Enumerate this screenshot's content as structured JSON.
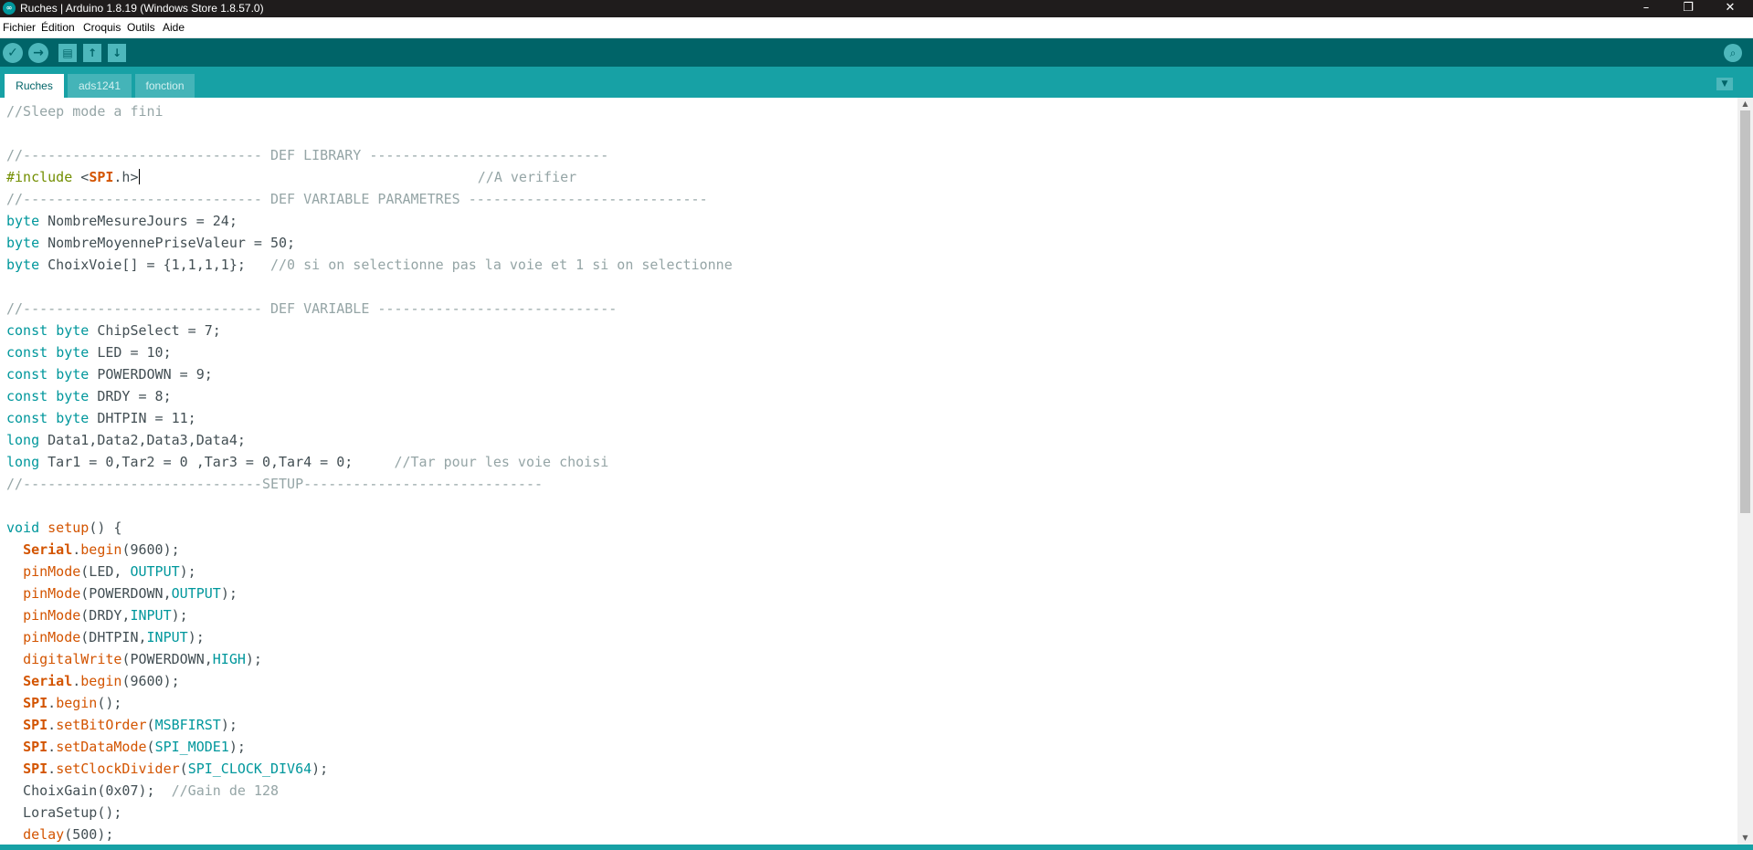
{
  "window": {
    "title": "Ruches | Arduino 1.8.19 (Windows Store 1.8.57.0)",
    "app_icon_text": "∞",
    "controls": {
      "minimize": "–",
      "restore": "❐",
      "close": "✕"
    }
  },
  "menu": [
    "Fichier",
    "Édition",
    "Croquis",
    "Outils",
    "Aide"
  ],
  "toolbar": {
    "verify_icon": "✓",
    "upload_icon": "→",
    "new_icon": "▤",
    "open_icon": "↑",
    "save_icon": "↓",
    "serial_monitor_icon": "⌕"
  },
  "tabs": [
    {
      "label": "Ruches",
      "active": true
    },
    {
      "label": "ads1241",
      "active": false
    },
    {
      "label": "fonction",
      "active": false
    }
  ],
  "tab_menu_icon": "▼",
  "code": [
    [
      [
        "cm",
        "//Sleep mode a fini"
      ]
    ],
    [],
    [
      [
        "cm",
        "//----------------------------- DEF LIBRARY -----------------------------"
      ]
    ],
    [
      [
        "pp",
        "#include "
      ],
      [
        "txt",
        "<"
      ],
      [
        "lib",
        "SPI"
      ],
      [
        "txt",
        ".h>"
      ],
      [
        "cursor",
        ""
      ],
      [
        "txt",
        "                                         "
      ],
      [
        "cm",
        "//A verifier"
      ]
    ],
    [
      [
        "cm",
        "//----------------------------- DEF VARIABLE PARAMETRES -----------------------------"
      ]
    ],
    [
      [
        "kw",
        "byte"
      ],
      [
        "txt",
        " NombreMesureJours = 24;"
      ]
    ],
    [
      [
        "kw",
        "byte"
      ],
      [
        "txt",
        " NombreMoyennePriseValeur = 50;"
      ]
    ],
    [
      [
        "kw",
        "byte"
      ],
      [
        "txt",
        " ChoixVoie[] = {1,1,1,1};   "
      ],
      [
        "cm",
        "//0 si on selectionne pas la voie et 1 si on selectionne"
      ]
    ],
    [],
    [
      [
        "cm",
        "//----------------------------- DEF VARIABLE -----------------------------"
      ]
    ],
    [
      [
        "kw",
        "const"
      ],
      [
        "txt",
        " "
      ],
      [
        "kw",
        "byte"
      ],
      [
        "txt",
        " ChipSelect = 7;"
      ]
    ],
    [
      [
        "kw",
        "const"
      ],
      [
        "txt",
        " "
      ],
      [
        "kw",
        "byte"
      ],
      [
        "txt",
        " LED = 10;"
      ]
    ],
    [
      [
        "kw",
        "const"
      ],
      [
        "txt",
        " "
      ],
      [
        "kw",
        "byte"
      ],
      [
        "txt",
        " POWERDOWN = 9;"
      ]
    ],
    [
      [
        "kw",
        "const"
      ],
      [
        "txt",
        " "
      ],
      [
        "kw",
        "byte"
      ],
      [
        "txt",
        " DRDY = 8;"
      ]
    ],
    [
      [
        "kw",
        "const"
      ],
      [
        "txt",
        " "
      ],
      [
        "kw",
        "byte"
      ],
      [
        "txt",
        " DHTPIN = 11;"
      ]
    ],
    [
      [
        "kw",
        "long"
      ],
      [
        "txt",
        " Data1,Data2,Data3,Data4;"
      ]
    ],
    [
      [
        "kw",
        "long"
      ],
      [
        "txt",
        " Tar1 = 0,Tar2 = 0 ,Tar3 = 0,Tar4 = 0;     "
      ],
      [
        "cm",
        "//Tar pour les voie choisi"
      ]
    ],
    [
      [
        "cm",
        "//-----------------------------SETUP-----------------------------"
      ]
    ],
    [],
    [
      [
        "kw",
        "void"
      ],
      [
        "txt",
        " "
      ],
      [
        "fn",
        "setup"
      ],
      [
        "txt",
        "() {"
      ]
    ],
    [
      [
        "txt",
        "  "
      ],
      [
        "lib",
        "Serial"
      ],
      [
        "txt",
        "."
      ],
      [
        "fn",
        "begin"
      ],
      [
        "txt",
        "(9600);"
      ]
    ],
    [
      [
        "txt",
        "  "
      ],
      [
        "fn",
        "pinMode"
      ],
      [
        "txt",
        "(LED, "
      ],
      [
        "kw",
        "OUTPUT"
      ],
      [
        "txt",
        ");"
      ]
    ],
    [
      [
        "txt",
        "  "
      ],
      [
        "fn",
        "pinMode"
      ],
      [
        "txt",
        "(POWERDOWN,"
      ],
      [
        "kw",
        "OUTPUT"
      ],
      [
        "txt",
        ");"
      ]
    ],
    [
      [
        "txt",
        "  "
      ],
      [
        "fn",
        "pinMode"
      ],
      [
        "txt",
        "(DRDY,"
      ],
      [
        "kw",
        "INPUT"
      ],
      [
        "txt",
        ");"
      ]
    ],
    [
      [
        "txt",
        "  "
      ],
      [
        "fn",
        "pinMode"
      ],
      [
        "txt",
        "(DHTPIN,"
      ],
      [
        "kw",
        "INPUT"
      ],
      [
        "txt",
        ");"
      ]
    ],
    [
      [
        "txt",
        "  "
      ],
      [
        "fn",
        "digitalWrite"
      ],
      [
        "txt",
        "(POWERDOWN,"
      ],
      [
        "kw",
        "HIGH"
      ],
      [
        "txt",
        ");"
      ]
    ],
    [
      [
        "txt",
        "  "
      ],
      [
        "lib",
        "Serial"
      ],
      [
        "txt",
        "."
      ],
      [
        "fn",
        "begin"
      ],
      [
        "txt",
        "(9600);"
      ]
    ],
    [
      [
        "txt",
        "  "
      ],
      [
        "lib",
        "SPI"
      ],
      [
        "txt",
        "."
      ],
      [
        "fn",
        "begin"
      ],
      [
        "txt",
        "();"
      ]
    ],
    [
      [
        "txt",
        "  "
      ],
      [
        "lib",
        "SPI"
      ],
      [
        "txt",
        "."
      ],
      [
        "fn",
        "setBitOrder"
      ],
      [
        "txt",
        "("
      ],
      [
        "kw",
        "MSBFIRST"
      ],
      [
        "txt",
        ");"
      ]
    ],
    [
      [
        "txt",
        "  "
      ],
      [
        "lib",
        "SPI"
      ],
      [
        "txt",
        "."
      ],
      [
        "fn",
        "setDataMode"
      ],
      [
        "txt",
        "("
      ],
      [
        "kw",
        "SPI_MODE1"
      ],
      [
        "txt",
        ");"
      ]
    ],
    [
      [
        "txt",
        "  "
      ],
      [
        "lib",
        "SPI"
      ],
      [
        "txt",
        "."
      ],
      [
        "fn",
        "setClockDivider"
      ],
      [
        "txt",
        "("
      ],
      [
        "kw",
        "SPI_CLOCK_DIV64"
      ],
      [
        "txt",
        ");"
      ]
    ],
    [
      [
        "txt",
        "  ChoixGain(0x07);  "
      ],
      [
        "cm",
        "//Gain de 128"
      ]
    ],
    [
      [
        "txt",
        "  LoraSetup();"
      ]
    ],
    [
      [
        "txt",
        "  "
      ],
      [
        "fn",
        "delay"
      ],
      [
        "txt",
        "(500);"
      ]
    ]
  ],
  "scrollbar": {
    "up_icon": "▲",
    "down_icon": "▼"
  }
}
